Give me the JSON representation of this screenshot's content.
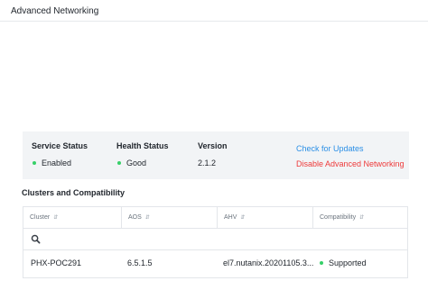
{
  "header": {
    "title": "Advanced Networking"
  },
  "status": {
    "service": {
      "label": "Service Status",
      "value": "Enabled"
    },
    "health": {
      "label": "Health Status",
      "value": "Good"
    },
    "version": {
      "label": "Version",
      "value": "2.1.2"
    },
    "actions": {
      "check_updates": "Check for Updates",
      "disable": "Disable Advanced Networking"
    },
    "colors": {
      "ok_dot": "#36d068",
      "link": "#2b8fe6",
      "danger": "#ee3a3a"
    }
  },
  "clusters": {
    "title": "Clusters and Compatibility",
    "columns": [
      "Cluster",
      "AOS",
      "AHV",
      "Compatibility"
    ],
    "search_icon": "search-icon",
    "rows": [
      {
        "cluster": "PHX-POC291",
        "aos": "6.5.1.5",
        "ahv": "el7.nutanix.20201105.3...",
        "compatibility": "Supported"
      }
    ]
  }
}
